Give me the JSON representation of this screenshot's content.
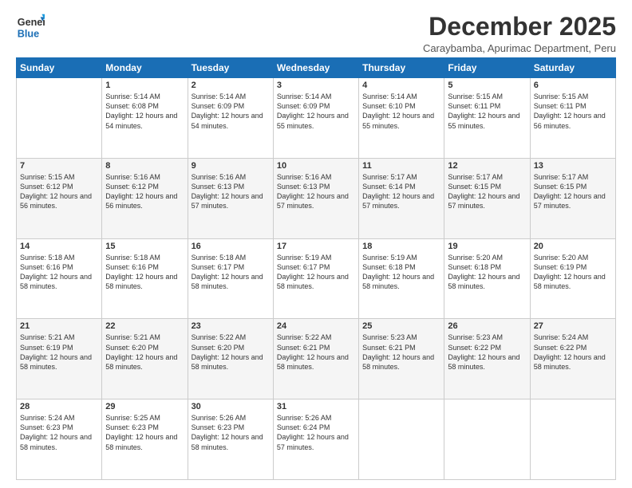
{
  "logo": {
    "line1": "General",
    "line2": "Blue"
  },
  "header": {
    "month": "December 2025",
    "location": "Caraybamba, Apurimac Department, Peru"
  },
  "days": [
    "Sunday",
    "Monday",
    "Tuesday",
    "Wednesday",
    "Thursday",
    "Friday",
    "Saturday"
  ],
  "weeks": [
    [
      {
        "date": "",
        "sunrise": "",
        "sunset": "",
        "daylight": ""
      },
      {
        "date": "1",
        "sunrise": "Sunrise: 5:14 AM",
        "sunset": "Sunset: 6:08 PM",
        "daylight": "Daylight: 12 hours and 54 minutes."
      },
      {
        "date": "2",
        "sunrise": "Sunrise: 5:14 AM",
        "sunset": "Sunset: 6:09 PM",
        "daylight": "Daylight: 12 hours and 54 minutes."
      },
      {
        "date": "3",
        "sunrise": "Sunrise: 5:14 AM",
        "sunset": "Sunset: 6:09 PM",
        "daylight": "Daylight: 12 hours and 55 minutes."
      },
      {
        "date": "4",
        "sunrise": "Sunrise: 5:14 AM",
        "sunset": "Sunset: 6:10 PM",
        "daylight": "Daylight: 12 hours and 55 minutes."
      },
      {
        "date": "5",
        "sunrise": "Sunrise: 5:15 AM",
        "sunset": "Sunset: 6:11 PM",
        "daylight": "Daylight: 12 hours and 55 minutes."
      },
      {
        "date": "6",
        "sunrise": "Sunrise: 5:15 AM",
        "sunset": "Sunset: 6:11 PM",
        "daylight": "Daylight: 12 hours and 56 minutes."
      }
    ],
    [
      {
        "date": "7",
        "sunrise": "Sunrise: 5:15 AM",
        "sunset": "Sunset: 6:12 PM",
        "daylight": "Daylight: 12 hours and 56 minutes."
      },
      {
        "date": "8",
        "sunrise": "Sunrise: 5:16 AM",
        "sunset": "Sunset: 6:12 PM",
        "daylight": "Daylight: 12 hours and 56 minutes."
      },
      {
        "date": "9",
        "sunrise": "Sunrise: 5:16 AM",
        "sunset": "Sunset: 6:13 PM",
        "daylight": "Daylight: 12 hours and 57 minutes."
      },
      {
        "date": "10",
        "sunrise": "Sunrise: 5:16 AM",
        "sunset": "Sunset: 6:13 PM",
        "daylight": "Daylight: 12 hours and 57 minutes."
      },
      {
        "date": "11",
        "sunrise": "Sunrise: 5:17 AM",
        "sunset": "Sunset: 6:14 PM",
        "daylight": "Daylight: 12 hours and 57 minutes."
      },
      {
        "date": "12",
        "sunrise": "Sunrise: 5:17 AM",
        "sunset": "Sunset: 6:15 PM",
        "daylight": "Daylight: 12 hours and 57 minutes."
      },
      {
        "date": "13",
        "sunrise": "Sunrise: 5:17 AM",
        "sunset": "Sunset: 6:15 PM",
        "daylight": "Daylight: 12 hours and 57 minutes."
      }
    ],
    [
      {
        "date": "14",
        "sunrise": "Sunrise: 5:18 AM",
        "sunset": "Sunset: 6:16 PM",
        "daylight": "Daylight: 12 hours and 58 minutes."
      },
      {
        "date": "15",
        "sunrise": "Sunrise: 5:18 AM",
        "sunset": "Sunset: 6:16 PM",
        "daylight": "Daylight: 12 hours and 58 minutes."
      },
      {
        "date": "16",
        "sunrise": "Sunrise: 5:18 AM",
        "sunset": "Sunset: 6:17 PM",
        "daylight": "Daylight: 12 hours and 58 minutes."
      },
      {
        "date": "17",
        "sunrise": "Sunrise: 5:19 AM",
        "sunset": "Sunset: 6:17 PM",
        "daylight": "Daylight: 12 hours and 58 minutes."
      },
      {
        "date": "18",
        "sunrise": "Sunrise: 5:19 AM",
        "sunset": "Sunset: 6:18 PM",
        "daylight": "Daylight: 12 hours and 58 minutes."
      },
      {
        "date": "19",
        "sunrise": "Sunrise: 5:20 AM",
        "sunset": "Sunset: 6:18 PM",
        "daylight": "Daylight: 12 hours and 58 minutes."
      },
      {
        "date": "20",
        "sunrise": "Sunrise: 5:20 AM",
        "sunset": "Sunset: 6:19 PM",
        "daylight": "Daylight: 12 hours and 58 minutes."
      }
    ],
    [
      {
        "date": "21",
        "sunrise": "Sunrise: 5:21 AM",
        "sunset": "Sunset: 6:19 PM",
        "daylight": "Daylight: 12 hours and 58 minutes."
      },
      {
        "date": "22",
        "sunrise": "Sunrise: 5:21 AM",
        "sunset": "Sunset: 6:20 PM",
        "daylight": "Daylight: 12 hours and 58 minutes."
      },
      {
        "date": "23",
        "sunrise": "Sunrise: 5:22 AM",
        "sunset": "Sunset: 6:20 PM",
        "daylight": "Daylight: 12 hours and 58 minutes."
      },
      {
        "date": "24",
        "sunrise": "Sunrise: 5:22 AM",
        "sunset": "Sunset: 6:21 PM",
        "daylight": "Daylight: 12 hours and 58 minutes."
      },
      {
        "date": "25",
        "sunrise": "Sunrise: 5:23 AM",
        "sunset": "Sunset: 6:21 PM",
        "daylight": "Daylight: 12 hours and 58 minutes."
      },
      {
        "date": "26",
        "sunrise": "Sunrise: 5:23 AM",
        "sunset": "Sunset: 6:22 PM",
        "daylight": "Daylight: 12 hours and 58 minutes."
      },
      {
        "date": "27",
        "sunrise": "Sunrise: 5:24 AM",
        "sunset": "Sunset: 6:22 PM",
        "daylight": "Daylight: 12 hours and 58 minutes."
      }
    ],
    [
      {
        "date": "28",
        "sunrise": "Sunrise: 5:24 AM",
        "sunset": "Sunset: 6:23 PM",
        "daylight": "Daylight: 12 hours and 58 minutes."
      },
      {
        "date": "29",
        "sunrise": "Sunrise: 5:25 AM",
        "sunset": "Sunset: 6:23 PM",
        "daylight": "Daylight: 12 hours and 58 minutes."
      },
      {
        "date": "30",
        "sunrise": "Sunrise: 5:26 AM",
        "sunset": "Sunset: 6:23 PM",
        "daylight": "Daylight: 12 hours and 58 minutes."
      },
      {
        "date": "31",
        "sunrise": "Sunrise: 5:26 AM",
        "sunset": "Sunset: 6:24 PM",
        "daylight": "Daylight: 12 hours and 57 minutes."
      },
      {
        "date": "",
        "sunrise": "",
        "sunset": "",
        "daylight": ""
      },
      {
        "date": "",
        "sunrise": "",
        "sunset": "",
        "daylight": ""
      },
      {
        "date": "",
        "sunrise": "",
        "sunset": "",
        "daylight": ""
      }
    ]
  ]
}
